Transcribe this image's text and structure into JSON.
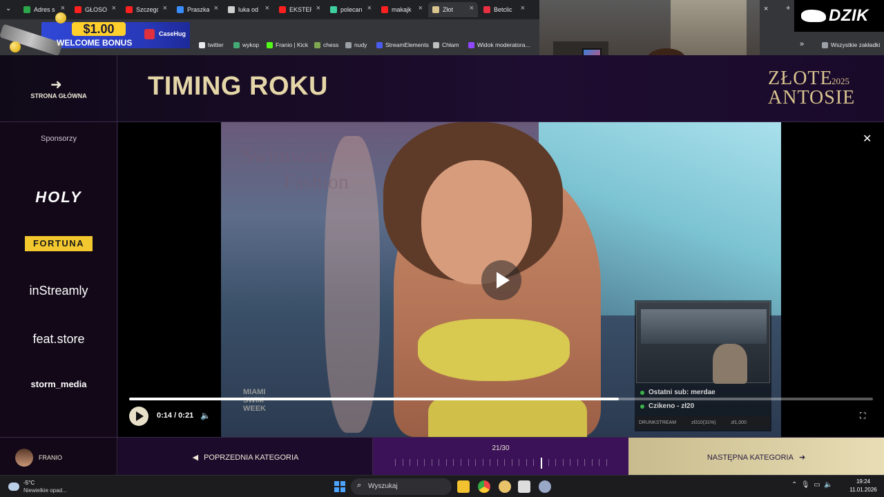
{
  "browser": {
    "tabs": [
      {
        "label": "Adres s",
        "color": "#2aa84a"
      },
      {
        "label": "GŁOSO",
        "color": "#ff2020"
      },
      {
        "label": "Szczegó",
        "color": "#ff2020"
      },
      {
        "label": "Praszka",
        "color": "#3a8dff"
      },
      {
        "label": "luka od",
        "color": "#cfcfcf"
      },
      {
        "label": "EKSTER",
        "color": "#ff2020"
      },
      {
        "label": "polecan",
        "color": "#3fd0a0"
      },
      {
        "label": "makajk",
        "color": "#ff2020"
      },
      {
        "label": "Złot",
        "color": "#d9c590"
      },
      {
        "label": "Betclic",
        "color": "#e83040"
      }
    ],
    "bookmarks": [
      {
        "label": "twitter",
        "icon": "x-icon"
      },
      {
        "label": "wykop",
        "icon": "wykop-icon"
      },
      {
        "label": "Franio | Kick",
        "icon": "kick-icon"
      },
      {
        "label": "chess",
        "icon": "chess-icon"
      },
      {
        "label": "nudy",
        "icon": "folder-icon"
      },
      {
        "label": "StreamElements",
        "icon": "streamelements-icon"
      },
      {
        "label": "Chłam",
        "icon": "globe-icon"
      },
      {
        "label": "Widok moderatora...",
        "icon": "twitch-icon"
      }
    ],
    "all_bookmarks": "Wszystkie zakładki"
  },
  "ad": {
    "amount": "$1.00",
    "welcome": "WELCOME BONUS",
    "brand": "CaseHug"
  },
  "overlay": {
    "brand": "DZIK"
  },
  "site": {
    "home_label": "STRONA GŁÓWNA",
    "title": "TIMING ROKU",
    "logo_line1": "ZŁOTE",
    "logo_line2": "ANTOSIE",
    "logo_year": "2025",
    "sponsors_title": "Sponsorzy",
    "sponsors": [
      "HOLY",
      "FORTUNA",
      "inStreamly",
      "feat.store",
      "storm_media"
    ]
  },
  "player": {
    "time": "0:14 / 0:21",
    "progress_fraction": 0.658,
    "video_watermark_1": "Swimwear",
    "video_watermark_2": "Fashion",
    "video_event": "MIAMI SWIM WEEK",
    "stream_sub": "Ostatni sub: merdae",
    "stream_tip": "Czikeno - zł20",
    "stream_footer": [
      "DRUNKSTREAM",
      "zł310(31%)",
      "zł1,000"
    ]
  },
  "footer": {
    "username": "FRANIO",
    "prev_label": "POPRZEDNIA KATEGORIA",
    "counter": "21/30",
    "current_index": 21,
    "total": 30,
    "next_label": "NASTĘPNA KATEGORIA"
  },
  "taskbar": {
    "temperature": "-5°C",
    "weather_desc": "Niewielkie opad...",
    "search_placeholder": "Wyszukaj",
    "time": "19:24",
    "date": "11.01.2026"
  },
  "colors": {
    "gold": "#e5d6a8",
    "purple_accent": "#3b1258",
    "fortuna_yellow": "#f2c82e"
  }
}
